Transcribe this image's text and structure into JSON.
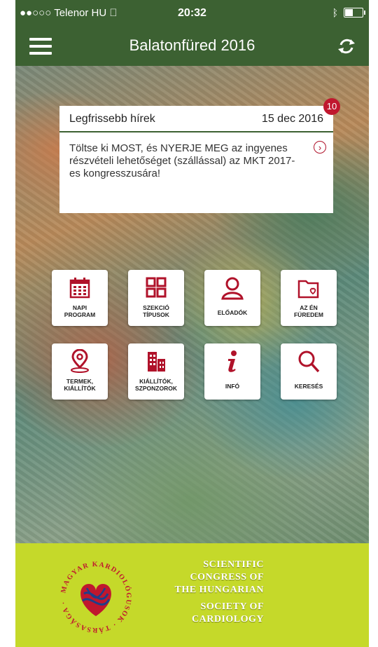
{
  "status": {
    "carrier": "●●○○○ Telenor HU",
    "time": "20:32"
  },
  "nav": {
    "title": "Balatonfüred 2016"
  },
  "news": {
    "header": "Legfrissebb hírek",
    "date": "15 dec 2016",
    "badge": "10",
    "text": "Töltse ki MOST, és NYERJE MEG az ingyenes részvételi lehetőséget (szállással) az MKT 2017-es kongresszusára!"
  },
  "tiles": [
    {
      "line1": "NAPI",
      "line2": "PROGRAM",
      "icon": "calendar-icon"
    },
    {
      "line1": "SZEKCIÓ",
      "line2": "TÍPUSOK",
      "icon": "grid-icon"
    },
    {
      "line1": "ELŐADÓK",
      "line2": "",
      "icon": "person-icon"
    },
    {
      "line1": "AZ ÉN",
      "line2": "FÜREDEM",
      "icon": "heart-folder-icon"
    },
    {
      "line1": "TERMEK,",
      "line2": "KIÁLLÍTÓK",
      "icon": "map-pin-icon"
    },
    {
      "line1": "KIÁLLÍTÓK,",
      "line2": "SZPONZOROK",
      "icon": "buildings-icon"
    },
    {
      "line1": "INFÓ",
      "line2": "",
      "icon": "info-icon"
    },
    {
      "line1": "KERESÉS",
      "line2": "",
      "icon": "search-icon"
    }
  ],
  "footer": {
    "logo_text": "MAGYAR KARDIOLÓGUSOK TÁRSASÁGA",
    "line1": "SCIENTIFIC",
    "line2": "CONGRESS OF",
    "line3": "THE HUNGARIAN",
    "line4": "SOCIETY OF",
    "line5": "CARDIOLOGY"
  },
  "colors": {
    "header_green": "#3c6132",
    "accent_red": "#b0122a",
    "footer_lime": "#c5d92a"
  }
}
